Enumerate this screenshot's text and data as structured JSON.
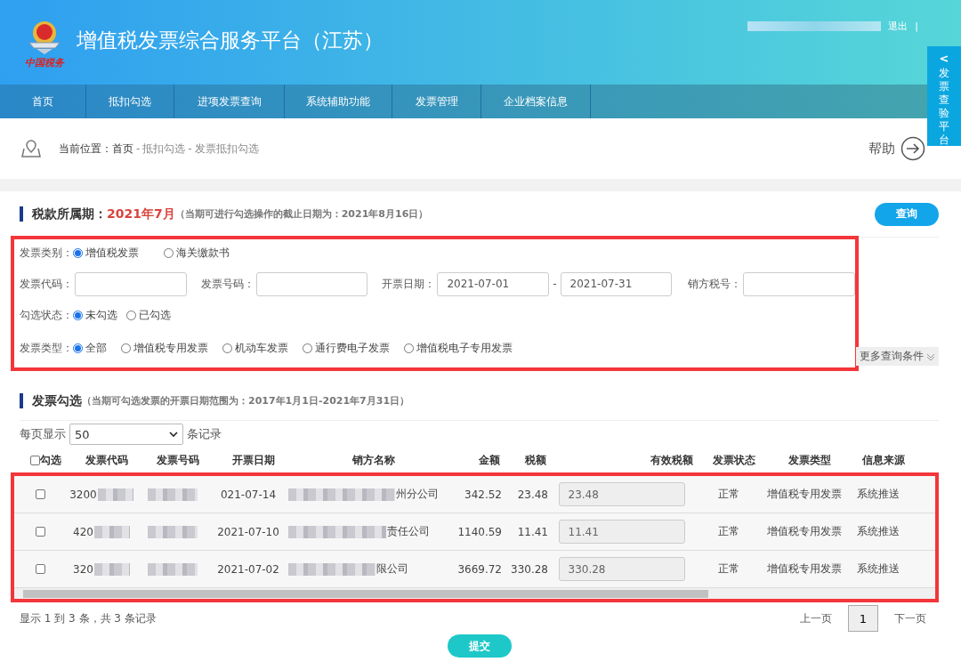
{
  "header": {
    "title": "增值税发票综合服务平台（江苏）",
    "logo_caption": "中国税务",
    "logout": "退出",
    "separator": "|"
  },
  "side_tab": {
    "arrow": "<",
    "label": "发票查验平台"
  },
  "nav": [
    {
      "label": "首页"
    },
    {
      "label": "抵扣勾选"
    },
    {
      "label": "进项发票查询"
    },
    {
      "label": "系统辅助功能"
    },
    {
      "label": "发票管理"
    },
    {
      "label": "企业档案信息"
    }
  ],
  "breadcrumb": {
    "prefix": "当前位置：",
    "items": [
      {
        "label": "首页",
        "kind": "link"
      },
      {
        "label": "-",
        "kind": "sep"
      },
      {
        "label": "抵扣勾选",
        "kind": "link"
      },
      {
        "label": "-",
        "kind": "sep"
      },
      {
        "label": "发票抵扣勾选",
        "kind": "current"
      }
    ]
  },
  "help": "帮助",
  "period": {
    "label": "税款所属期：",
    "value": "2021年7月",
    "note": "（当期可进行勾选操作的截止日期为：2021年8月16日）",
    "button": "查询"
  },
  "filters": [
    {
      "kind": "radio",
      "label": "发票类别：",
      "options": [
        {
          "label": "增值税发票",
          "selected": true
        },
        {
          "label": "海关缴款书",
          "selected": false
        }
      ]
    },
    {
      "kind": "fields",
      "items": [
        {
          "kind": "text",
          "label": "发票代码："
        },
        {
          "kind": "text",
          "label": "发票号码："
        },
        {
          "kind": "range",
          "label": "开票日期：",
          "from": "2021-07-01",
          "separator": "-",
          "to": "2021-07-31"
        },
        {
          "kind": "text",
          "label": "销方税号："
        }
      ]
    },
    {
      "kind": "radio",
      "label": "勾选状态：",
      "options": [
        {
          "label": "未勾选",
          "selected": true
        },
        {
          "label": "已勾选",
          "selected": false
        }
      ]
    },
    {
      "kind": "radio",
      "label": "发票类型：",
      "options": [
        {
          "label": "全部",
          "selected": true
        },
        {
          "label": "增值税专用发票",
          "selected": false
        },
        {
          "label": "机动车发票",
          "selected": false
        },
        {
          "label": "通行费电子发票",
          "selected": false
        },
        {
          "label": "增值税电子专用发票",
          "selected": false
        }
      ]
    }
  ],
  "more_conditions": "更多查询条件",
  "selection": {
    "title": "发票勾选",
    "note": "（当期可勾选发票的开票日期范围为：2017年1月1日-2021年7月31日）"
  },
  "page_size": {
    "label": "每页显示",
    "value": "50",
    "suffix": "条记录"
  },
  "table": {
    "select_all": {
      "label": "勾选",
      "checked": false
    },
    "columns": [
      "发票代码",
      "发票号码",
      "开票日期",
      "销方名称",
      "金额",
      "税额",
      "有效税额",
      "发票状态",
      "发票类型",
      "信息来源"
    ],
    "rows": [
      {
        "checked": false,
        "code": "3200",
        "date": "021-07-14",
        "seller": "州分公司",
        "amount": "342.52",
        "tax": "23.48",
        "effective": "23.48",
        "status": "正常",
        "type": "增值税专用发票",
        "source": "系统推送"
      },
      {
        "checked": false,
        "code": "420",
        "date": "2021-07-10",
        "seller": "责任公司",
        "amount": "1140.59",
        "tax": "11.41",
        "effective": "11.41",
        "status": "正常",
        "type": "增值税专用发票",
        "source": "系统推送"
      },
      {
        "checked": false,
        "code": "320",
        "date": "2021-07-02",
        "seller": "限公司",
        "amount": "3669.72",
        "tax": "330.28",
        "effective": "330.28",
        "status": "正常",
        "type": "增值税专用发票",
        "source": "系统推送"
      }
    ]
  },
  "summary": "显示 1 到 3 条，共 3 条记录",
  "pagination": {
    "prev": "上一页",
    "pages": [
      {
        "label": "1",
        "selected": true
      }
    ],
    "next": "下一页"
  },
  "submit": "提交"
}
